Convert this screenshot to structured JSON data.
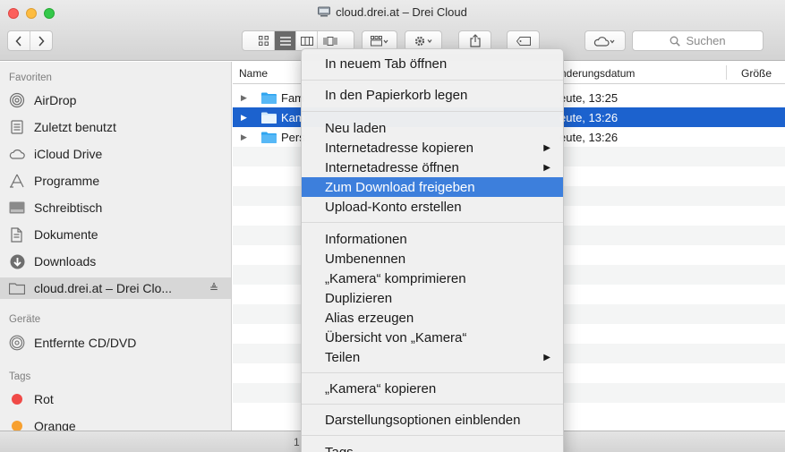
{
  "window": {
    "title": "cloud.drei.at – Drei Cloud"
  },
  "toolbar": {
    "search_placeholder": "Suchen"
  },
  "sidebar": {
    "favorites_label": "Favoriten",
    "favorites": [
      {
        "label": "AirDrop",
        "icon": "airdrop-icon"
      },
      {
        "label": "Zuletzt benutzt",
        "icon": "recents-icon"
      },
      {
        "label": "iCloud Drive",
        "icon": "cloud-icon"
      },
      {
        "label": "Programme",
        "icon": "applications-icon"
      },
      {
        "label": "Schreibtisch",
        "icon": "desktop-icon"
      },
      {
        "label": "Dokumente",
        "icon": "documents-icon"
      },
      {
        "label": "Downloads",
        "icon": "downloads-icon"
      },
      {
        "label": "cloud.drei.at – Drei Clo...",
        "icon": "folder-icon",
        "eject": "≜"
      }
    ],
    "devices_label": "Geräte",
    "devices": [
      {
        "label": "Entfernte CD/DVD",
        "icon": "disc-icon"
      }
    ],
    "tags_label": "Tags",
    "tags": [
      {
        "label": "Rot",
        "color": "#f04a47"
      },
      {
        "label": "Orange",
        "color": "#f7a030"
      }
    ]
  },
  "list": {
    "columns": [
      "Name",
      "nderungsdatum",
      "Größe"
    ],
    "rows": [
      {
        "name": "Fam",
        "date": "eute, 13:25",
        "selected": false
      },
      {
        "name": "Kam",
        "date": "eute, 13:26",
        "selected": true
      },
      {
        "name": "Pers",
        "date": "eute, 13:26",
        "selected": false
      }
    ]
  },
  "status": {
    "count": "1"
  },
  "context_menu": {
    "items": [
      {
        "label": "In neuem Tab öffnen"
      },
      {
        "label": "In den Papierkorb legen"
      },
      {
        "label": "Neu laden"
      },
      {
        "label": "Internetadresse kopieren",
        "submenu": true
      },
      {
        "label": "Internetadresse öffnen",
        "submenu": true
      },
      {
        "label": "Zum Download freigeben",
        "highlighted": true
      },
      {
        "label": "Upload-Konto erstellen"
      },
      {
        "label": "Informationen"
      },
      {
        "label": "Umbenennen"
      },
      {
        "label": "„Kamera“ komprimieren"
      },
      {
        "label": "Duplizieren"
      },
      {
        "label": "Alias erzeugen"
      },
      {
        "label": "Übersicht von „Kamera“"
      },
      {
        "label": "Teilen",
        "submenu": true
      },
      {
        "label": "„Kamera“ kopieren"
      },
      {
        "label": "Darstellungsoptionen einblenden"
      },
      {
        "label": "Tags ..."
      }
    ],
    "submenu_arrow": "▶"
  },
  "colors": {
    "selection": "#1c62ce",
    "menu_highlight": "#3d7fdc"
  }
}
